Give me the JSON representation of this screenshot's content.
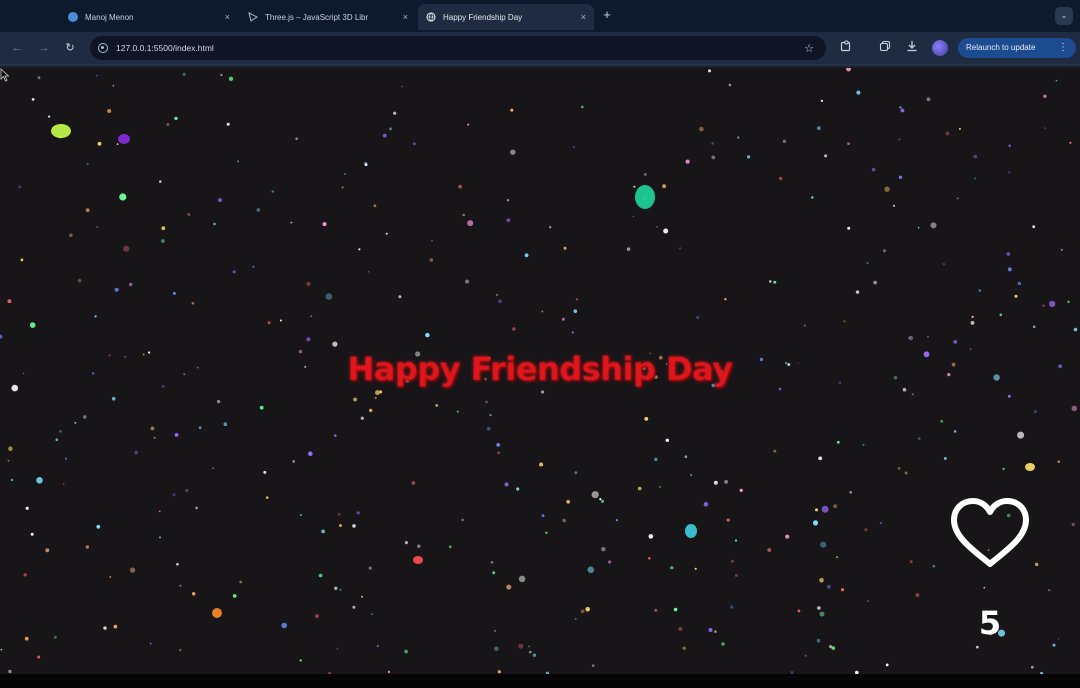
{
  "browser": {
    "tabs": [
      {
        "title": "Manoj Menon",
        "favicon": "globe-icon",
        "active": false
      },
      {
        "title": "Three.js – JavaScript 3D Libr",
        "favicon": "threejs-icon",
        "active": false
      },
      {
        "title": "Happy Friendship Day",
        "favicon": "globe-icon",
        "active": true
      }
    ],
    "new_tab_glyph": "+",
    "tab_close_glyph": "×",
    "url": "127.0.0.1:5500/index.html",
    "relaunch_label": "Relaunch to update",
    "menu_glyph": "⋮",
    "accent": "#1c4b8f"
  },
  "page": {
    "headline": "Happy Friendship Day",
    "headline_color": "#e0161c",
    "background": "#171518"
  },
  "overlay": {
    "like_icon": "heart-outline-icon",
    "like_count": "5"
  }
}
